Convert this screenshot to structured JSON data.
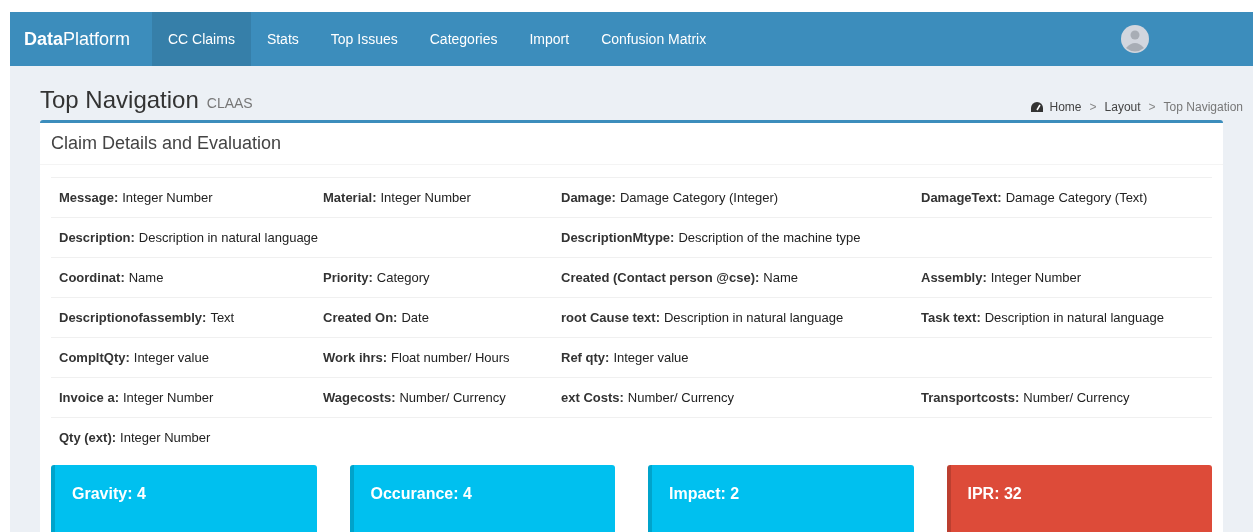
{
  "navbar": {
    "brand_bold": "Data",
    "brand_rest": "Platform",
    "items": [
      {
        "label": "CC Claims",
        "selected": true
      },
      {
        "label": "Stats",
        "selected": false
      },
      {
        "label": "Top Issues",
        "selected": false
      },
      {
        "label": "Categories",
        "selected": false
      },
      {
        "label": "Import",
        "selected": false
      },
      {
        "label": "Confusion Matrix",
        "selected": false
      }
    ]
  },
  "page_header": {
    "title": "Top Navigation",
    "subtitle": "CLAAS",
    "breadcrumb": [
      {
        "label": "Home",
        "current": false
      },
      {
        "label": "Layout",
        "current": false
      },
      {
        "label": "Top Navigation",
        "current": true
      }
    ],
    "separator": ">"
  },
  "panel": {
    "title": "Claim Details and Evaluation",
    "rows": [
      [
        {
          "label": "Message:",
          "value": "Integer Number"
        },
        {
          "label": "Material:",
          "value": "Integer Number"
        },
        {
          "label": "Damage:",
          "value": "Damage Category (Integer)"
        },
        {
          "label": "DamageText:",
          "value": "Damage Category (Text)"
        }
      ],
      [
        {
          "label": "Description:",
          "value": "Description in natural language"
        },
        "",
        {
          "label": "DescriptionMtype:",
          "value": "Description of the machine type"
        }
      ],
      [
        {
          "label": "Coordinat:",
          "value": "Name"
        },
        {
          "label": "Priority:",
          "value": "Category"
        },
        {
          "label": "Created (Contact person @cse):",
          "value": "Name"
        },
        {
          "label": "Assembly:",
          "value": "Integer Number"
        }
      ],
      [
        {
          "label": "Descriptionofassembly:",
          "value": "Text"
        },
        {
          "label": "Created On:",
          "value": "Date"
        },
        {
          "label": "root Cause text:",
          "value": "Description in natural language"
        },
        {
          "label": "Task text:",
          "value": "Description in natural language"
        }
      ],
      [
        {
          "label": "CompltQty:",
          "value": "Integer value"
        },
        {
          "label": "Work ihrs:",
          "value": "Float number/ Hours"
        },
        {
          "label": "Ref qty:",
          "value": "Integer value"
        }
      ],
      [
        {
          "label": "Invoice a:",
          "value": "Integer Number"
        },
        {
          "label": "Wagecosts:",
          "value": "Number/ Currency"
        },
        {
          "label": "ext Costs:",
          "value": "Number/ Currency"
        },
        {
          "label": "Transportcosts:",
          "value": "Number/ Currency"
        }
      ],
      [
        {
          "label": "Qty (ext):",
          "value": "Integer Number"
        }
      ]
    ]
  },
  "scores": [
    {
      "label": "Gravity: 4",
      "color": "#00c0ef"
    },
    {
      "label": "Occurance: 4",
      "color": "#00c0ef"
    },
    {
      "label": "Impact: 2",
      "color": "#00c0ef"
    },
    {
      "label": "IPR: 32",
      "color": "#dd4b39"
    }
  ]
}
